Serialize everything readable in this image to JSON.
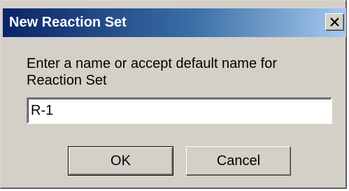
{
  "dialog": {
    "title": "New Reaction Set",
    "prompt": "Enter a name or accept default name for Reaction Set",
    "name_value": "R-1",
    "ok_label": "OK",
    "cancel_label": "Cancel",
    "close_icon": "close-icon"
  },
  "colors": {
    "titlebar_start": "#0a246a",
    "titlebar_end": "#a6caf0",
    "dialog_face": "#d4d0c8"
  }
}
